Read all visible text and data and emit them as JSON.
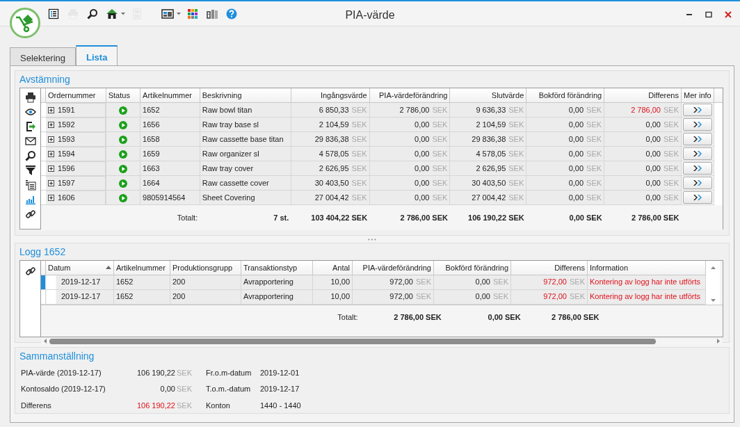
{
  "window": {
    "title": "PIA-värde"
  },
  "toolbar": [
    {
      "kind": "list",
      "disabled": false,
      "dropdown": false
    },
    {
      "kind": "print",
      "disabled": true,
      "dropdown": false
    },
    {
      "kind": "search",
      "disabled": false,
      "dropdown": false
    },
    {
      "kind": "home",
      "disabled": false,
      "dropdown": true
    },
    {
      "kind": "save",
      "disabled": true,
      "dropdown": false
    },
    {
      "kind": "layout",
      "disabled": false,
      "dropdown": true
    },
    {
      "kind": "apps",
      "disabled": false,
      "dropdown": false
    },
    {
      "kind": "book",
      "disabled": false,
      "dropdown": false
    },
    {
      "kind": "help",
      "disabled": false,
      "dropdown": false
    }
  ],
  "tabs": [
    {
      "label": "Selektering",
      "selected": false
    },
    {
      "label": "Lista",
      "selected": true
    }
  ],
  "reconciliation": {
    "title": "Avstämning",
    "tools": [
      {
        "kind": "print"
      },
      {
        "kind": "view"
      },
      {
        "kind": "export"
      },
      {
        "kind": "mail"
      },
      {
        "kind": "search"
      },
      {
        "kind": "filter"
      },
      {
        "kind": "report"
      },
      {
        "kind": "chart"
      },
      {
        "kind": "link"
      }
    ],
    "columns": [
      {
        "label": "Ordernummer"
      },
      {
        "label": "Status"
      },
      {
        "label": "Artikelnummer"
      },
      {
        "label": "Beskrivning"
      },
      {
        "label": "Ingångsvärde"
      },
      {
        "label": "PIA-värdeförändring"
      },
      {
        "label": "Slutvärde"
      },
      {
        "label": "Bokförd förändring"
      },
      {
        "label": "Differens"
      },
      {
        "label": "Mer info"
      }
    ],
    "rows": [
      {
        "order": "1591",
        "article": "1652",
        "description": "Raw bowl titan",
        "values": [
          {
            "amount": "6 850,33",
            "unit": "SEK",
            "alert": false
          },
          {
            "amount": "2 786,00",
            "unit": "SEK",
            "alert": false
          },
          {
            "amount": "9 636,33",
            "unit": "SEK",
            "alert": false
          },
          {
            "amount": "0,00",
            "unit": "SEK",
            "alert": false
          },
          {
            "amount": "2 786,00",
            "unit": "SEK",
            "alert": true
          }
        ]
      },
      {
        "order": "1592",
        "article": "1656",
        "description": "Raw tray base sl",
        "values": [
          {
            "amount": "2 104,59",
            "unit": "SEK",
            "alert": false
          },
          {
            "amount": "0,00",
            "unit": "SEK",
            "alert": false
          },
          {
            "amount": "2 104,59",
            "unit": "SEK",
            "alert": false
          },
          {
            "amount": "0,00",
            "unit": "SEK",
            "alert": false
          },
          {
            "amount": "0,00",
            "unit": "SEK",
            "alert": false
          }
        ]
      },
      {
        "order": "1593",
        "article": "1658",
        "description": "Raw cassette base titan",
        "values": [
          {
            "amount": "29 836,38",
            "unit": "SEK",
            "alert": false
          },
          {
            "amount": "0,00",
            "unit": "SEK",
            "alert": false
          },
          {
            "amount": "29 836,38",
            "unit": "SEK",
            "alert": false
          },
          {
            "amount": "0,00",
            "unit": "SEK",
            "alert": false
          },
          {
            "amount": "0,00",
            "unit": "SEK",
            "alert": false
          }
        ]
      },
      {
        "order": "1594",
        "article": "1659",
        "description": "Raw organizer sl",
        "values": [
          {
            "amount": "4 578,05",
            "unit": "SEK",
            "alert": false
          },
          {
            "amount": "0,00",
            "unit": "SEK",
            "alert": false
          },
          {
            "amount": "4 578,05",
            "unit": "SEK",
            "alert": false
          },
          {
            "amount": "0,00",
            "unit": "SEK",
            "alert": false
          },
          {
            "amount": "0,00",
            "unit": "SEK",
            "alert": false
          }
        ]
      },
      {
        "order": "1596",
        "article": "1663",
        "description": "Raw tray cover",
        "values": [
          {
            "amount": "2 626,95",
            "unit": "SEK",
            "alert": false
          },
          {
            "amount": "0,00",
            "unit": "SEK",
            "alert": false
          },
          {
            "amount": "2 626,95",
            "unit": "SEK",
            "alert": false
          },
          {
            "amount": "0,00",
            "unit": "SEK",
            "alert": false
          },
          {
            "amount": "0,00",
            "unit": "SEK",
            "alert": false
          }
        ]
      },
      {
        "order": "1597",
        "article": "1664",
        "description": "Raw cassette cover",
        "values": [
          {
            "amount": "30 403,50",
            "unit": "SEK",
            "alert": false
          },
          {
            "amount": "0,00",
            "unit": "SEK",
            "alert": false
          },
          {
            "amount": "30 403,50",
            "unit": "SEK",
            "alert": false
          },
          {
            "amount": "0,00",
            "unit": "SEK",
            "alert": false
          },
          {
            "amount": "0,00",
            "unit": "SEK",
            "alert": false
          }
        ]
      },
      {
        "order": "1606",
        "article": "9805914564",
        "description": "Sheet Covering",
        "values": [
          {
            "amount": "27 004,42",
            "unit": "SEK",
            "alert": false
          },
          {
            "amount": "0,00",
            "unit": "SEK",
            "alert": false
          },
          {
            "amount": "27 004,42",
            "unit": "SEK",
            "alert": false
          },
          {
            "amount": "0,00",
            "unit": "SEK",
            "alert": false
          },
          {
            "amount": "0,00",
            "unit": "SEK",
            "alert": false
          }
        ]
      }
    ],
    "totals": {
      "label": "Totalt:",
      "count": "7 st.",
      "values": [
        "103 404,22 SEK",
        "2 786,00 SEK",
        "106 190,22 SEK",
        "0,00 SEK",
        "2 786,00 SEK"
      ]
    }
  },
  "log": {
    "title": "Logg 1652",
    "columns": [
      {
        "label": "Datum",
        "sorted": true
      },
      {
        "label": "Artikelnummer",
        "sorted": false
      },
      {
        "label": "Produktionsgrupp",
        "sorted": false
      },
      {
        "label": "Transaktionstyp",
        "sorted": false
      },
      {
        "label": "Antal",
        "sorted": false
      },
      {
        "label": "PIA-värdeförändring",
        "sorted": false
      },
      {
        "label": "Bokförd förändring",
        "sorted": false
      },
      {
        "label": "Differens",
        "sorted": false
      },
      {
        "label": "Information",
        "sorted": false
      }
    ],
    "rows": [
      {
        "selected": true,
        "date": "2019-12-17",
        "article": "1652",
        "group": "200",
        "type": "Avrapportering",
        "quantity": "10,00",
        "values": [
          {
            "amount": "972,00",
            "unit": "SEK",
            "alert": false
          },
          {
            "amount": "0,00",
            "unit": "SEK",
            "alert": false
          },
          {
            "amount": "972,00",
            "unit": "SEK",
            "alert": true
          }
        ],
        "info": "Kontering av logg har inte utförts"
      },
      {
        "selected": false,
        "date": "2019-12-17",
        "article": "1652",
        "group": "200",
        "type": "Avrapportering",
        "quantity": "10,00",
        "values": [
          {
            "amount": "972,00",
            "unit": "SEK",
            "alert": false
          },
          {
            "amount": "0,00",
            "unit": "SEK",
            "alert": false
          },
          {
            "amount": "972,00",
            "unit": "SEK",
            "alert": true
          }
        ],
        "info": "Kontering av logg har inte utförts"
      }
    ],
    "totals": {
      "label": "Totalt:",
      "values": [
        "2 786,00 SEK",
        "0,00 SEK",
        "2 786,00 SEK"
      ]
    }
  },
  "summary": {
    "title": "Sammanställning",
    "amounts": [
      {
        "label": "PIA-värde (2019-12-17)",
        "amount": "106 190,22",
        "unit": "SEK",
        "alert": false
      },
      {
        "label": "Kontosaldo (2019-12-17)",
        "amount": "0,00",
        "unit": "SEK",
        "alert": false
      },
      {
        "label": "Differens",
        "amount": "106 190,22",
        "unit": "SEK",
        "alert": true
      }
    ],
    "details": [
      {
        "label": "Fr.o.m-datum",
        "value": "2019-12-01"
      },
      {
        "label": "T.o.m.-datum",
        "value": "2019-12-17"
      },
      {
        "label": "Konton",
        "value": "1440 - 1440"
      }
    ]
  }
}
